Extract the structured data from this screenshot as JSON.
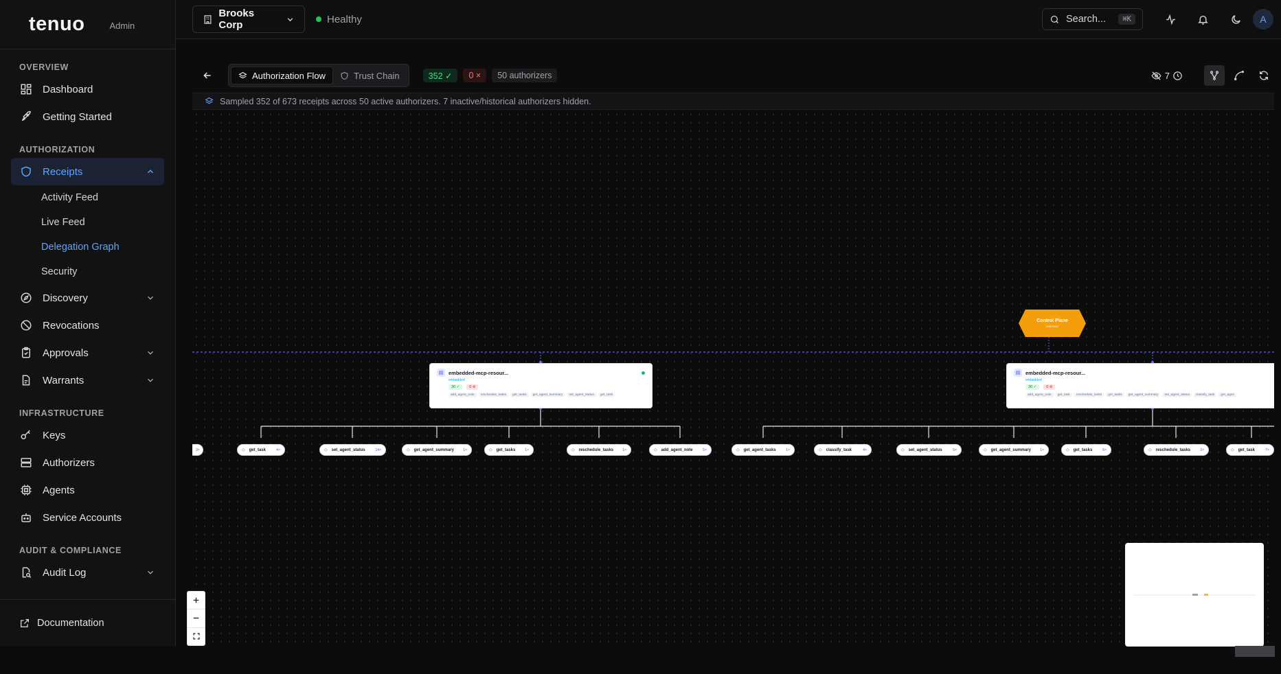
{
  "brand": {
    "name": "tenuo",
    "role": "Admin"
  },
  "sidebar": {
    "sections": {
      "overview": "OVERVIEW",
      "authorization": "AUTHORIZATION",
      "infrastructure": "INFRASTRUCTURE",
      "audit": "AUDIT & COMPLIANCE"
    },
    "items": {
      "dashboard": "Dashboard",
      "getting_started": "Getting Started",
      "receipts": "Receipts",
      "activity_feed": "Activity Feed",
      "live_feed": "Live Feed",
      "delegation_graph": "Delegation Graph",
      "security": "Security",
      "discovery": "Discovery",
      "revocations": "Revocations",
      "approvals": "Approvals",
      "warrants": "Warrants",
      "keys": "Keys",
      "authorizers": "Authorizers",
      "agents": "Agents",
      "service_accounts": "Service Accounts",
      "audit_log": "Audit Log"
    },
    "footer": "Documentation"
  },
  "topbar": {
    "org": "Brooks Corp",
    "health": "Healthy",
    "search_label": "Search...",
    "search_shortcut": "⌘K",
    "avatar": "A"
  },
  "toolbar": {
    "tabs": [
      "Authorization Flow",
      "Trust Chain"
    ],
    "ok_count": "352 ✓",
    "err_count": "0 ×",
    "authorizers": "50 authorizers",
    "hidden_count": "7"
  },
  "info": "Sampled 352 of 673 receipts across 50 active authorizers. 7 inactive/historical authorizers hidden.",
  "graph": {
    "control_plane": {
      "title": "Control Plane",
      "sub": "unknown"
    },
    "cards": [
      {
        "name": "embedded-mcp-resour...",
        "type": "embedded",
        "ok": "30 ✓",
        "err": "0 ⊘",
        "tools": [
          "add_agent_note",
          "reschedule_tasks",
          "get_tasks",
          "get_agent_summary",
          "set_agent_status",
          "get_task"
        ]
      },
      {
        "name": "embedded-mcp-resour...",
        "type": "embedded",
        "ok": "30 ✓",
        "err": "0 ⊘",
        "tools": [
          "add_agent_note",
          "get_task",
          "reschedule_tasks",
          "get_tasks",
          "get_agent_summary",
          "set_agent_status",
          "classify_task",
          "get_agen"
        ]
      }
    ],
    "tool_nodes": [
      {
        "name": "",
        "count": "3×"
      },
      {
        "name": "get_task",
        "count": "4×"
      },
      {
        "name": "set_agent_status",
        "count": "14×"
      },
      {
        "name": "get_agent_summary",
        "count": "1×"
      },
      {
        "name": "get_tasks",
        "count": "1×"
      },
      {
        "name": "reschedule_tasks",
        "count": "1×"
      },
      {
        "name": "add_agent_note",
        "count": "5×"
      },
      {
        "name": "get_agent_tasks",
        "count": "1×"
      },
      {
        "name": "classify_task",
        "count": "4×"
      },
      {
        "name": "set_agent_status",
        "count": "5×"
      },
      {
        "name": "get_agent_summary",
        "count": "1×"
      },
      {
        "name": "get_tasks",
        "count": "6×"
      },
      {
        "name": "reschedule_tasks",
        "count": "2×"
      },
      {
        "name": "get_task",
        "count": "7×"
      }
    ]
  },
  "colors": {
    "accent": "#60a5fa",
    "success": "#22c55e",
    "control_plane": "#f59e0b",
    "danger": "#f87171"
  }
}
